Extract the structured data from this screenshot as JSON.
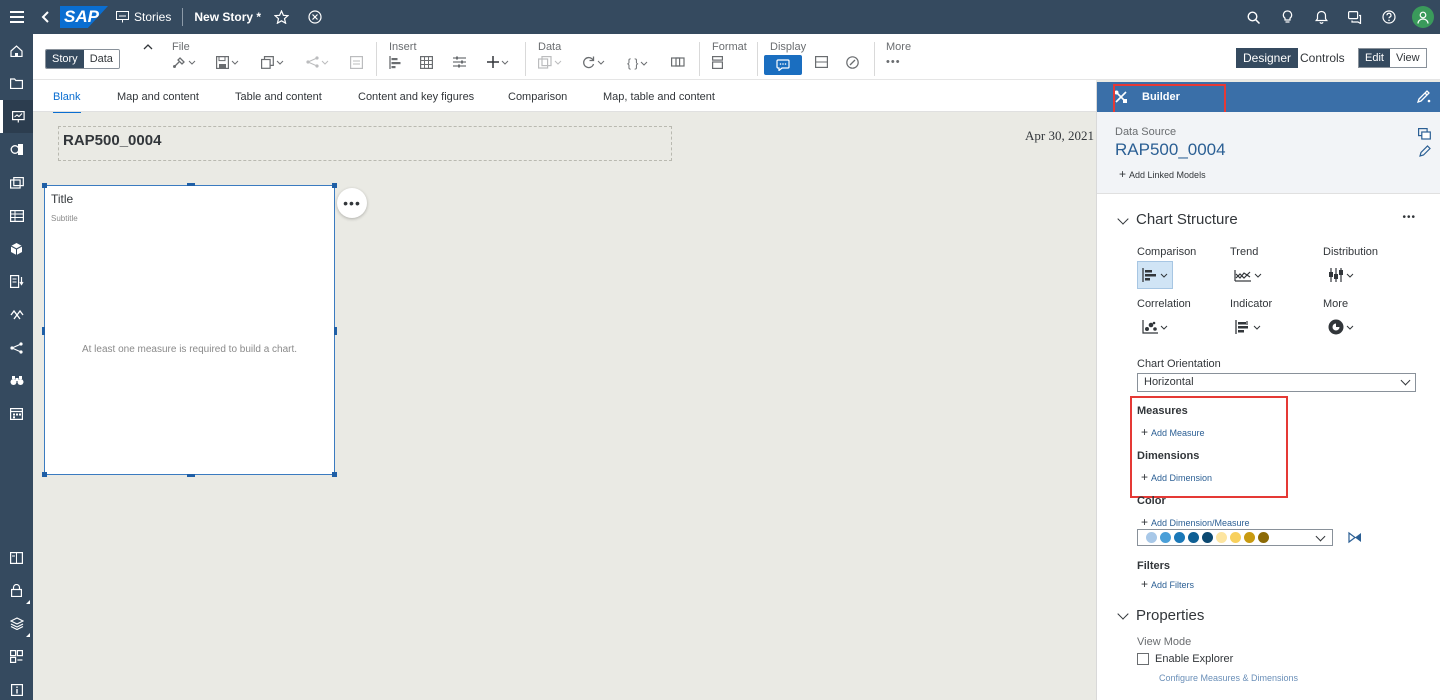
{
  "topbar": {
    "logo": "SAP",
    "stories_label": "Stories",
    "story_name": "New Story",
    "modified_marker": "*"
  },
  "toolbar": {
    "story_tab": "Story",
    "data_tab": "Data",
    "file_label": "File",
    "insert_label": "Insert",
    "data_label": "Data",
    "format_label": "Format",
    "display_label": "Display",
    "more_label": "More",
    "designer_label": "Designer",
    "controls_label": "Controls",
    "edit_label": "Edit",
    "view_label": "View"
  },
  "layout_tabs": [
    {
      "label": "Blank",
      "active": true
    },
    {
      "label": "Map and content"
    },
    {
      "label": "Table and content"
    },
    {
      "label": "Content and key figures"
    },
    {
      "label": "Comparison"
    },
    {
      "label": "Map, table and content"
    }
  ],
  "canvas": {
    "header_title": "RAP500_0004",
    "date": "Apr 30, 2021",
    "chart_title": "Title",
    "chart_subtitle": "Subtitle",
    "chart_message": "At least one measure is required to build a chart.",
    "more_dots": "•••"
  },
  "builder": {
    "title": "Builder",
    "data_source_label": "Data Source",
    "data_source_name": "RAP500_0004",
    "add_linked_models": "Add Linked Models",
    "chart_structure_title": "Chart Structure",
    "more_dots": "•••",
    "categories": [
      "Comparison",
      "Trend",
      "Distribution",
      "Correlation",
      "Indicator",
      "More"
    ],
    "chart_orientation_label": "Chart Orientation",
    "chart_orientation_value": "Horizontal",
    "measures_label": "Measures",
    "add_measure": "Add Measure",
    "dimensions_label": "Dimensions",
    "add_dimension": "Add Dimension",
    "color_label": "Color",
    "add_dimension_measure": "Add Dimension/Measure",
    "palette": [
      "#a8c8e8",
      "#4a9fd8",
      "#1a78b8",
      "#0e5f94",
      "#0b4870",
      "#fde5a0",
      "#f8d05c",
      "#c89a10",
      "#8c6a06"
    ],
    "filters_label": "Filters",
    "add_filters": "Add Filters",
    "properties_title": "Properties",
    "view_mode_label": "View Mode",
    "enable_explorer": "Enable Explorer",
    "configure_link": "Configure Measures & Dimensions"
  },
  "colors": {
    "shell": "#354a5f",
    "accent": "#0a6ed1",
    "builder_header": "#3a6fa8",
    "highlight": "#e53935"
  }
}
